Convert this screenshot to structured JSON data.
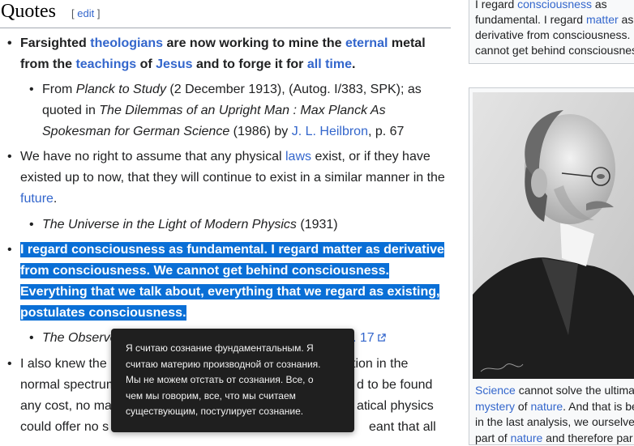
{
  "section": {
    "title": "Quotes",
    "edit_open": "[ ",
    "edit_label": "edit",
    "edit_close": " ]"
  },
  "quote1": {
    "l1_a": "Farsighted ",
    "l1_b": "theologians",
    "l1_c": " are now working to mine the ",
    "l1_d": "eternal",
    "l1_e": " metal",
    "l2_a": "from the ",
    "l2_b": "teachings",
    "l2_c": " of ",
    "l2_d": "Jesus",
    "l2_e": " and to forge it for ",
    "l2_f": "all time",
    "l2_g": "."
  },
  "source1": {
    "l1_a": "From ",
    "l1_b": "Planck to Study",
    "l1_c": " (2 December 1913), (Autog. I/383, SPK); as",
    "l2_a": "quoted in ",
    "l2_b": "The Dilemmas of an Upright Man : Max Planck As",
    "l3_a": "Spokesman for German Science",
    "l3_b": " (1986) by ",
    "l3_c": "J. L. Heilbron",
    "l3_d": ", p. 67"
  },
  "quote2": {
    "l1_a": "We have no right to assume that any physical ",
    "l1_b": "laws",
    "l1_c": " exist, or if they have",
    "l2": "existed up to now, that they will continue to exist in a similar manner in the",
    "l3_a": "future",
    "l3_b": "."
  },
  "source2": {
    "a": "The Universe in the Light of Modern Physics",
    "b": " (1931)"
  },
  "quote3": {
    "l1": "I regard consciousness as fundamental. I regard matter as derivative",
    "l2": "from consciousness. We cannot get behind consciousness.",
    "l3": "Everything that we talk about, everything that we regard as existing,",
    "l4": "postulates consciousness."
  },
  "source3": {
    "a": "The Observe",
    "b": ". 17"
  },
  "quote4": {
    "l1_a": "I also knew the",
    "l1_b": "tion in the",
    "l2_a": "normal spectrum",
    "l2_b": "d to be found at",
    "l3_a": "any cost, no ma",
    "l3_b": "ical physics",
    "l4_a": "could offer no s",
    "l4_b": "eant that all"
  },
  "sidebox": {
    "l1_a": "I regard ",
    "l1_b": "consciousness",
    "l1_c": " as",
    "l2_a": "fundamental. I regard ",
    "l2_b": "matter",
    "l2_c": " as",
    "l3": "derivative from consciousness.",
    "l4": "cannot get behind consciousnes"
  },
  "caption": {
    "l1_a": "Science",
    "l1_b": " cannot solve the ultima",
    "l2_a": "mystery",
    "l2_b": " of ",
    "l2_c": "nature",
    "l2_d": ". And that is be",
    "l3": "in the last analysis, we ourselve",
    "l4_a": "part of ",
    "l4_b": "nature",
    "l4_c": " and therefore par"
  },
  "tooltip": {
    "l1": "Я считаю сознание фундаментальным. Я",
    "l2": "считаю материю производной от сознания.",
    "l3": "Мы не можем отстать от сознания. Все, о",
    "l4": "чем мы говорим, все, что мы считаем",
    "l5": "существующим, постулирует сознание."
  },
  "icons": {
    "external_link": "external-link-icon"
  },
  "colors": {
    "link": "#3366cc",
    "selection": "#0a6fd6",
    "tooltip_bg": "#1f1f1f"
  }
}
